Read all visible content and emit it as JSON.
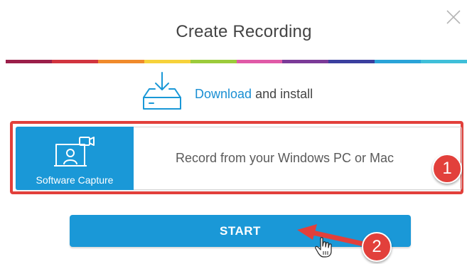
{
  "dialog": {
    "title": "Create Recording",
    "close_icon": "close-icon"
  },
  "color_bar": [
    "#9b1f4a",
    "#d1343f",
    "#f08a2c",
    "#f6d23a",
    "#9ccb3b",
    "#e05aa7",
    "#7b3a98",
    "#3a3f9f",
    "#2aa3d8",
    "#3fbfd9"
  ],
  "download": {
    "icon": "download-tray-icon",
    "link_label": "Download",
    "suffix": " and install"
  },
  "option": {
    "tile_icon": "webcam-screen-icon",
    "tile_label": "Software Capture",
    "description": "Record from your Windows PC or Mac"
  },
  "annotations": {
    "badge_1": "1",
    "badge_2": "2"
  },
  "start_label": "START",
  "colors": {
    "accent": "#1a98d7",
    "highlight": "#e2403b"
  }
}
